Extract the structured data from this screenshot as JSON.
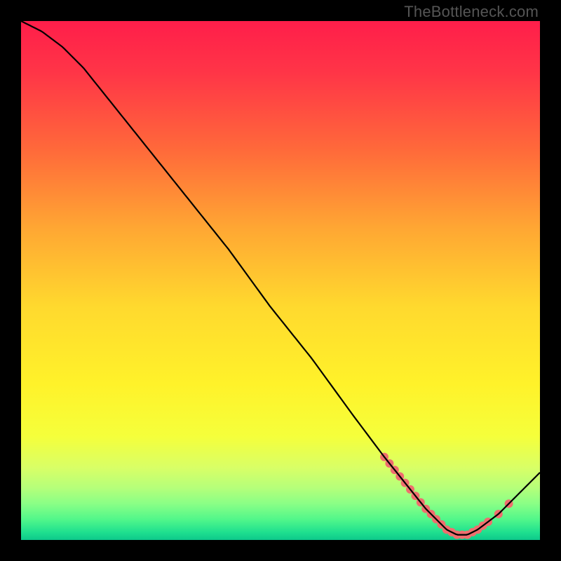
{
  "watermark": "TheBottleneck.com",
  "chart_data": {
    "type": "line",
    "title": "",
    "xlabel": "",
    "ylabel": "",
    "xlim": [
      0,
      100
    ],
    "ylim": [
      0,
      100
    ],
    "grid": false,
    "legend": false,
    "description": "Black curve descending from upper-left toward a minimum near x≈84 then rising, over a vertical red→yellow→green gradient on black frame.",
    "x": [
      0,
      4,
      8,
      12,
      16,
      24,
      32,
      40,
      48,
      56,
      64,
      70,
      74,
      78,
      80,
      82,
      84,
      86,
      88,
      92,
      96,
      100
    ],
    "values": [
      100,
      98,
      95,
      91,
      86,
      76,
      66,
      56,
      45,
      35,
      24,
      16,
      11,
      6,
      4,
      2,
      1,
      1,
      2,
      5,
      9,
      13
    ],
    "gradient_stops": [
      {
        "offset": 0.0,
        "color": "#ff1e4a"
      },
      {
        "offset": 0.1,
        "color": "#ff3547"
      },
      {
        "offset": 0.25,
        "color": "#ff6a3a"
      },
      {
        "offset": 0.4,
        "color": "#ffa733"
      },
      {
        "offset": 0.55,
        "color": "#ffd92e"
      },
      {
        "offset": 0.7,
        "color": "#fff22a"
      },
      {
        "offset": 0.8,
        "color": "#f5ff3b"
      },
      {
        "offset": 0.86,
        "color": "#d9ff66"
      },
      {
        "offset": 0.9,
        "color": "#b5ff7a"
      },
      {
        "offset": 0.93,
        "color": "#8aff86"
      },
      {
        "offset": 0.96,
        "color": "#52f78a"
      },
      {
        "offset": 0.985,
        "color": "#1fe08f"
      },
      {
        "offset": 1.0,
        "color": "#0dc98b"
      }
    ],
    "markers": {
      "color": "#ef6e6e",
      "radius": 6,
      "points_x": [
        70,
        71,
        72,
        73,
        74,
        75,
        76,
        77,
        78,
        79,
        80,
        81,
        82,
        83,
        84,
        85,
        86,
        87,
        88,
        89,
        90,
        92,
        94
      ]
    },
    "curve_stroke": "#000000",
    "curve_width": 2.2
  }
}
